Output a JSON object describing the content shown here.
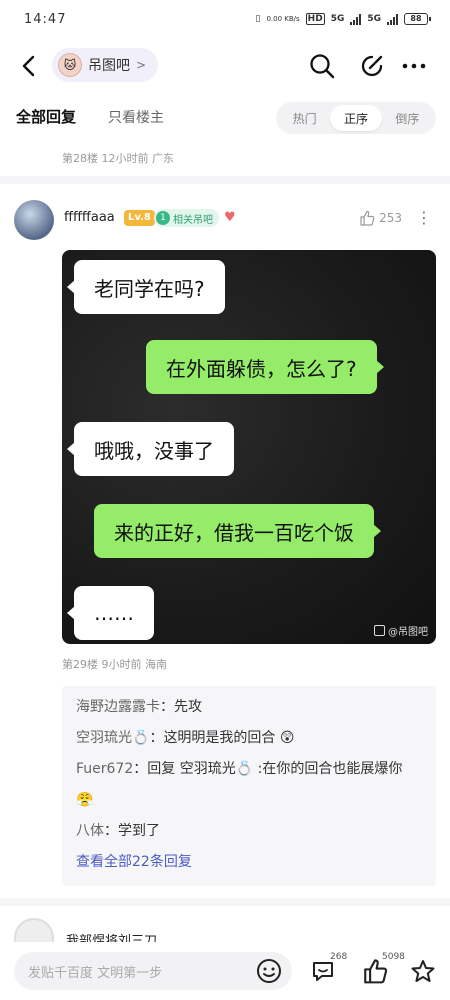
{
  "status_bar": {
    "time": "14:47",
    "network_speed": "0.00 KB/s",
    "hd_label": "HD",
    "signal1": "5G",
    "signal2": "5G",
    "battery": "88"
  },
  "header": {
    "forum_name": "吊图吧",
    "forum_chevron": ">"
  },
  "filter": {
    "all_replies": "全部回复",
    "owner_only": "只看楼主",
    "sort_options": [
      "热门",
      "正序",
      "倒序"
    ],
    "active_sort": "正序"
  },
  "prev_post_meta": "第28楼  12小时前  广东",
  "post": {
    "username": "ffffffaaa",
    "level": "Lv.8",
    "fan_badge_num": "1",
    "fan_badge_label": "相关吊吧",
    "like_count": "253",
    "chat": {
      "msg1": "老同学在吗?",
      "msg2": "在外面躲债，怎么了?",
      "msg3": "哦哦，没事了",
      "msg4": "来的正好，借我一百吃个饭",
      "msg5": "……"
    },
    "watermark": "@吊图吧",
    "meta": "第29楼  9小时前  海南"
  },
  "replies": [
    {
      "name": "海野边露露卡",
      "text": "先攻"
    },
    {
      "name": "空羽琉光💍",
      "text": "这明明是我的回合 😲"
    },
    {
      "name": "Fuer672",
      "text": "回复 空羽琉光💍 :在你的回合也能展爆你 😤"
    },
    {
      "name": "八体",
      "text": "学到了"
    }
  ],
  "view_all": "查看全部22条回复",
  "next_post": {
    "username": "我部煜将刘三刀"
  },
  "bottom_bar": {
    "placeholder": "发贴千百度 文明第一步",
    "comment_count": "268",
    "like_count": "5098"
  }
}
